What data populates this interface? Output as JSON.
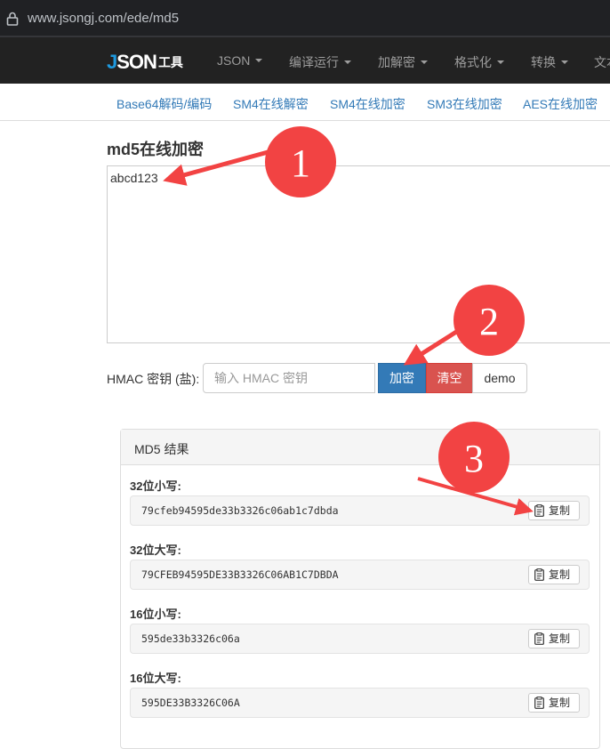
{
  "browser": {
    "url": "www.jsongj.com/ede/md5"
  },
  "nav": {
    "logo_main": "JSON",
    "logo_j": "J",
    "logo_rest": "SON",
    "logo_sub": "工具",
    "items": [
      {
        "label": "JSON"
      },
      {
        "label": "编译运行"
      },
      {
        "label": "加解密"
      },
      {
        "label": "格式化"
      },
      {
        "label": "转换"
      },
      {
        "label": "文本"
      }
    ]
  },
  "sublinks": [
    {
      "label": "Base64解码/编码"
    },
    {
      "label": "SM4在线解密"
    },
    {
      "label": "SM4在线加密"
    },
    {
      "label": "SM3在线加密"
    },
    {
      "label": "AES在线加密"
    }
  ],
  "page_title": "md5在线加密",
  "input_text": "abcd123",
  "hmac": {
    "label": "HMAC 密钥 (盐):",
    "placeholder": "输入 HMAC 密钥"
  },
  "buttons": {
    "encrypt": "加密",
    "clear": "清空",
    "demo": "demo"
  },
  "result": {
    "title": "MD5 结果",
    "copy_label": "复制",
    "rows": [
      {
        "label": "32位小写:",
        "value": "79cfeb94595de33b3326c06ab1c7dbda"
      },
      {
        "label": "32位大写:",
        "value": "79CFEB94595DE33B3326C06AB1C7DBDA"
      },
      {
        "label": "16位小写:",
        "value": "595de33b3326c06a"
      },
      {
        "label": "16位大写:",
        "value": "595DE33B3326C06A"
      }
    ]
  },
  "annotations": [
    "1",
    "2",
    "3"
  ],
  "colors": {
    "annotation_red": "#f24343",
    "primary": "#337ab7",
    "danger": "#d9534f"
  }
}
